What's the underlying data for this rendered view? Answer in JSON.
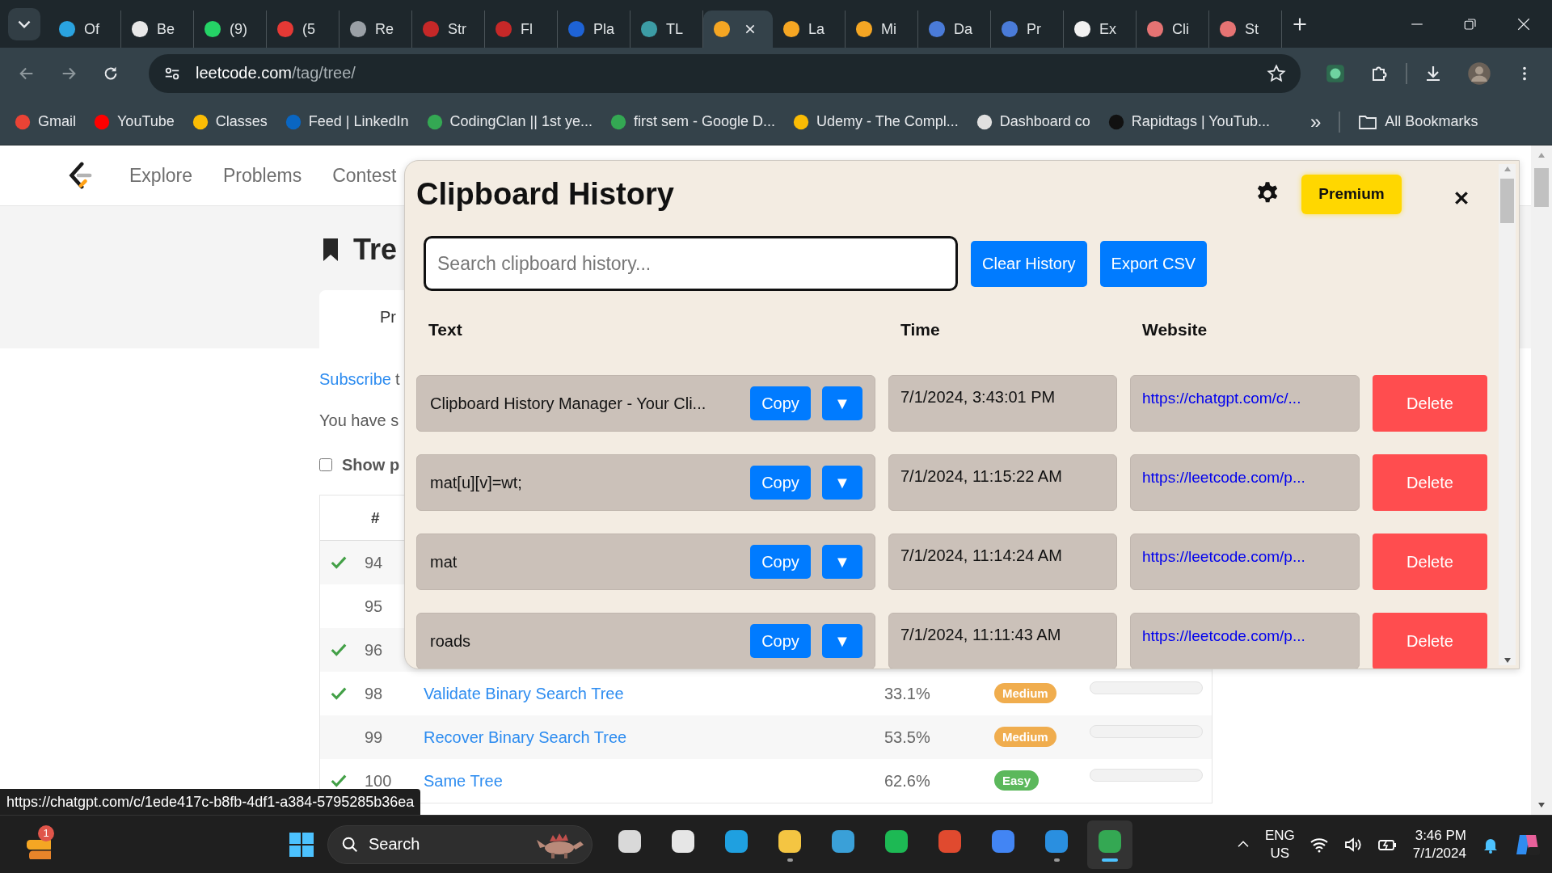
{
  "browser": {
    "tabs": [
      {
        "label": "Of",
        "selected": false,
        "color": "#2aa3e0"
      },
      {
        "label": "Be",
        "selected": false,
        "color": "#e8e8e8"
      },
      {
        "label": "(9)",
        "selected": false,
        "color": "#25d366"
      },
      {
        "label": "(5",
        "selected": false,
        "color": "#e53935"
      },
      {
        "label": "Re",
        "selected": false,
        "color": "#9aa0a6"
      },
      {
        "label": "Str",
        "selected": false,
        "color": "#c62828"
      },
      {
        "label": "Fl",
        "selected": false,
        "color": "#c62828"
      },
      {
        "label": "Pla",
        "selected": false,
        "color": "#1e63d6"
      },
      {
        "label": "TL",
        "selected": false,
        "color": "#3c9ca5"
      },
      {
        "selected": true,
        "color": "#f5a623"
      },
      {
        "label": "La",
        "selected": false,
        "color": "#f5a623"
      },
      {
        "label": "Mi",
        "selected": false,
        "color": "#f5a623"
      },
      {
        "label": "Da",
        "selected": false,
        "color": "#4a7bd8"
      },
      {
        "label": "Pr",
        "selected": false,
        "color": "#4a7bd8"
      },
      {
        "label": "Ex",
        "selected": false,
        "color": "#f1f1f1"
      },
      {
        "label": "Cli",
        "selected": false,
        "color": "#e57373"
      },
      {
        "label": "St",
        "selected": false,
        "color": "#e57373"
      }
    ],
    "address": {
      "host": "leetcode.com",
      "path": "/tag/tree/"
    },
    "bookmarks": [
      {
        "label": "Gmail",
        "color": "#ea4335"
      },
      {
        "label": "YouTube",
        "color": "#ff0000"
      },
      {
        "label": "Classes",
        "color": "#fbbc04"
      },
      {
        "label": "Feed | LinkedIn",
        "color": "#0a66c2"
      },
      {
        "label": "CodingClan || 1st ye...",
        "color": "#34a853"
      },
      {
        "label": "first sem - Google D...",
        "color": "#34a853"
      },
      {
        "label": "Udemy - The Compl...",
        "color": "#fbbc04"
      },
      {
        "label": "Dashboard co",
        "color": "#e0e0e0"
      },
      {
        "label": "Rapidtags | YouTub...",
        "color": "#111111"
      }
    ],
    "bookmarks_overflow": "»",
    "all_bookmarks": "All Bookmarks"
  },
  "page": {
    "nav": [
      "Explore",
      "Problems",
      "Contest"
    ],
    "heading": "Tre",
    "tab": "Pr",
    "subscribe_link": "Subscribe",
    "subscribe_rest": "t",
    "summary": "You have s",
    "show_checkbox": {
      "label": "Show p",
      "checked": false
    },
    "table": {
      "number_header": "#",
      "rows": [
        {
          "solved": true,
          "number": "94"
        },
        {
          "solved": false,
          "number": "95"
        },
        {
          "solved": true,
          "number": "96"
        },
        {
          "solved": true,
          "number": "98",
          "title": "Validate Binary Search Tree",
          "acceptance": "33.1%",
          "difficulty": "Medium",
          "color": "#f0ad4e"
        },
        {
          "solved": false,
          "number": "99",
          "title": "Recover Binary Search Tree",
          "acceptance": "53.5%",
          "difficulty": "Medium",
          "color": "#f0ad4e"
        },
        {
          "solved": true,
          "number": "100",
          "title": "Same Tree",
          "acceptance": "62.6%",
          "difficulty": "Easy",
          "color": "#5cb85c"
        }
      ]
    }
  },
  "popup": {
    "title": "Clipboard History",
    "premium": "Premium",
    "search": {
      "placeholder": "Search clipboard history..."
    },
    "buttons": [
      "Clear History",
      "Export CSV"
    ],
    "columns": [
      "Text",
      "Time",
      "Website"
    ],
    "entries": [
      {
        "text": "Clipboard History Manager - Your Cli...",
        "copy": "Copy",
        "expand": "▼",
        "time": "7/1/2024, 3:43:01 PM",
        "website": "https://chatgpt.com/c/...",
        "delete": "Delete"
      },
      {
        "text": "mat[u][v]=wt;",
        "copy": "Copy",
        "expand": "▼",
        "time": "7/1/2024, 11:15:22 AM",
        "website": "https://leetcode.com/p...",
        "delete": "Delete"
      },
      {
        "text": "mat",
        "copy": "Copy",
        "expand": "▼",
        "time": "7/1/2024, 11:14:24 AM",
        "website": "https://leetcode.com/p...",
        "delete": "Delete"
      },
      {
        "text": "roads",
        "copy": "Copy",
        "expand": "▼",
        "time": "7/1/2024, 11:11:43 AM",
        "website": "https://leetcode.com/p...",
        "delete": "Delete"
      }
    ]
  },
  "status_url": "https://chatgpt.com/c/1ede417c-b8fb-4df1-a384-5795285b36ea",
  "taskbar": {
    "badge": "1",
    "search": {
      "placeholder": "Search"
    },
    "apps": [
      {
        "color": "#d9d9d9",
        "running": false,
        "selected": false
      },
      {
        "color": "#e6e6e6",
        "running": false,
        "selected": false
      },
      {
        "color": "#1fa0e0",
        "running": false,
        "selected": false
      },
      {
        "color": "#f4c542",
        "running": true,
        "selected": false
      },
      {
        "color": "#3aa0d8",
        "running": false,
        "selected": false
      },
      {
        "color": "#1db954",
        "running": false,
        "selected": false
      },
      {
        "color": "#e04a2f",
        "running": false,
        "selected": false
      },
      {
        "color": "#4285f4",
        "running": false,
        "selected": false
      },
      {
        "color": "#2a8fe0",
        "running": true,
        "selected": false
      },
      {
        "color": "#34a853",
        "running": true,
        "selected": true
      }
    ],
    "language": "ENG",
    "region": "US",
    "time": "3:46 PM",
    "date": "7/1/2024"
  }
}
